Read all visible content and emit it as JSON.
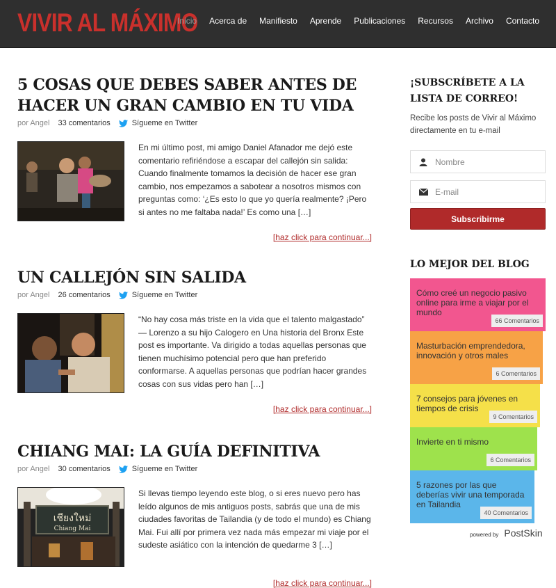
{
  "header": {
    "logo": "VIVIR AL MÁXIMO",
    "nav": [
      "Inicio",
      "Acerca de",
      "Manifiesto",
      "Aprende",
      "Publicaciones",
      "Recursos",
      "Archivo",
      "Contacto"
    ],
    "active_nav": "Inicio"
  },
  "posts": [
    {
      "title": "5 cosas que debes saber antes de hacer un gran cambio en tu vida",
      "author": "por Angel",
      "comments": "33 comentarios",
      "twitter": "Sígueme en Twitter",
      "excerpt": "En mi último post, mi amigo Daniel Afanador me dejó este comentario refiriéndose a escapar del callejón sin salida: Cuando finalmente tomamos la decisión de hacer ese gran cambio, nos empezamos a sabotear a nosotros mismos con preguntas como: ‘¿Es esto lo que yo quería realmente? ¡Pero si antes no me faltaba nada!’ Es como una […]",
      "more": "[haz click para continuar...]"
    },
    {
      "title": "Un callejón sin salida",
      "author": "por Angel",
      "comments": "26 comentarios",
      "twitter": "Sígueme en Twitter",
      "excerpt": "“No hay cosa más triste en la vida que el talento malgastado” — Lorenzo a su hijo Calogero en Una historia del Bronx Este post es importante. Va dirigido a todas aquellas personas que tienen muchísimo potencial pero que han preferido conformarse. A aquellas personas que podrían hacer grandes cosas con sus vidas pero han […]",
      "more": "[haz click para continuar...]"
    },
    {
      "title": "Chiang Mai: la guía definitiva",
      "author": "por Angel",
      "comments": "30 comentarios",
      "twitter": "Sígueme en Twitter",
      "excerpt": "Si llevas tiempo leyendo este blog, o si eres nuevo pero has leído algunos de mis antiguos posts, sabrás que una de mis ciudades favoritas de Tailandia (y de todo el mundo) es Chiang Mai. Fui allí por primera vez nada más empezar mi viaje por el sudeste asiático con la intención de quedarme 3 […]",
      "more": "[haz click para continuar...]",
      "sign_text": "เชียงใหม่",
      "sign_sub": "Chiang Mai"
    }
  ],
  "sidebar": {
    "subscribe_title": "¡Subscríbete a la lista de correo!",
    "subscribe_desc": "Recibe los posts de Vivir al Máximo directamente en tu e-mail",
    "name_placeholder": "Nombre",
    "email_placeholder": "E-mail",
    "subscribe_button": "Subscribirme",
    "best_title": "Lo mejor del blog",
    "best": [
      {
        "label": "Cómo creé un negocio pasivo online para irme a viajar por el mundo",
        "count": "66 Comentarios",
        "color": "#f2568f"
      },
      {
        "label": "Masturbación emprendedora, innovación y otros males",
        "count": "6 Comentarios",
        "color": "#f7a246"
      },
      {
        "label": "7 consejos para jóvenes en tiempos de crisis",
        "count": "9 Comentarios",
        "color": "#f5e049"
      },
      {
        "label": "Invierte en ti mismo",
        "count": "6 Comentarios",
        "color": "#9ee24c"
      },
      {
        "label": "5 razones por las que deberías vivir una temporada en Tailandia",
        "count": "40 Comentarios",
        "color": "#5bb6ea"
      }
    ],
    "powered_by": "powered by",
    "powered_brand": "PostSkin"
  },
  "colors": {
    "brand_red": "#c9302c",
    "link_red": "#b02a2a",
    "header_bg": "#2f2f2f",
    "twitter_blue": "#1da1f2"
  }
}
